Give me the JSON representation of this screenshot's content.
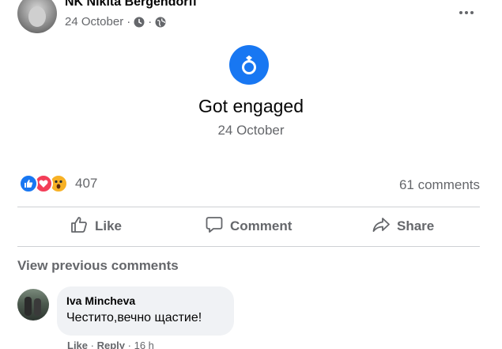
{
  "post": {
    "author": "NK Nikita Bergendorff",
    "date": "24 October",
    "meta_separator": "·"
  },
  "life_event": {
    "title": "Got engaged",
    "date": "24 October",
    "icon": "ring-icon"
  },
  "engagement": {
    "reaction_count": "407",
    "comment_count": "61 comments",
    "reactions": [
      "like",
      "love",
      "wow"
    ]
  },
  "actions": {
    "like": "Like",
    "comment": "Comment",
    "share": "Share"
  },
  "comments": {
    "view_previous": "View previous comments",
    "items": [
      {
        "author": "Iva Mincheva",
        "text": "Честито,вечно щастие!",
        "like": "Like",
        "reply": "Reply",
        "time": "16 h"
      }
    ]
  },
  "colors": {
    "accent": "#1877f2",
    "secondary_text": "#65676b",
    "love": "#f33e58",
    "wow": "#f7b125"
  }
}
